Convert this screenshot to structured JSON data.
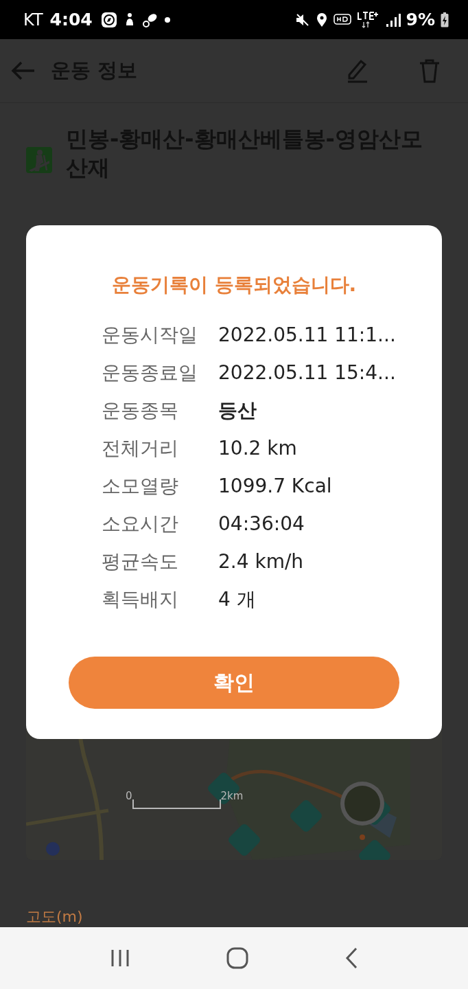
{
  "status_bar": {
    "carrier": "KT",
    "time": "4:04",
    "battery": "9%"
  },
  "app_bar": {
    "title": "운동 정보"
  },
  "activity": {
    "title": "민봉-황매산-황매산베틀봉-영암산모산재"
  },
  "map": {
    "kind": "picture",
    "scale_start": "0",
    "scale_end": "2km"
  },
  "elevation": {
    "label": "고도(m)"
  },
  "dialog": {
    "heading": "운동기록이 등록되었습니다.",
    "rows": [
      {
        "label": "운동시작일",
        "value": "2022.05.11 11:1...",
        "bold": false
      },
      {
        "label": "운동종료일",
        "value": "2022.05.11 15:4...",
        "bold": false
      },
      {
        "label": "운동종목",
        "value": "등산",
        "bold": true
      },
      {
        "label": "전체거리",
        "value": "10.2 km",
        "bold": false
      },
      {
        "label": "소모열량",
        "value": "1099.7 Kcal",
        "bold": false
      },
      {
        "label": "소요시간",
        "value": "04:36:04",
        "bold": false
      },
      {
        "label": "평균속도",
        "value": "2.4 km/h",
        "bold": false
      },
      {
        "label": "획득배지",
        "value": "4 개",
        "bold": false
      }
    ],
    "button": "확인"
  }
}
